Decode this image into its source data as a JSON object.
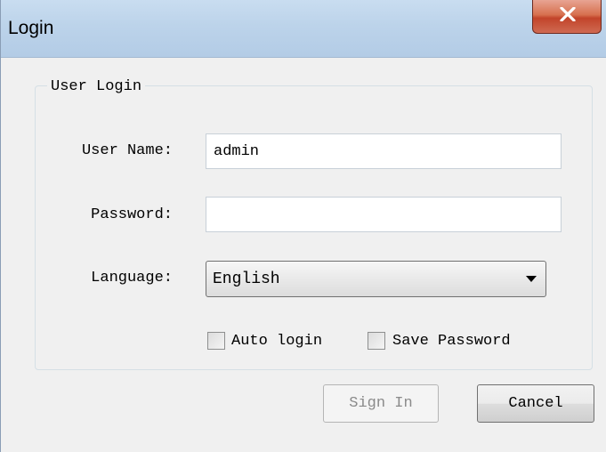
{
  "window": {
    "title": "Login",
    "close_label": "close"
  },
  "group": {
    "label": "User Login"
  },
  "fields": {
    "username": {
      "label": "User Name:",
      "value": "admin",
      "placeholder": ""
    },
    "password": {
      "label": "Password:",
      "value": "",
      "placeholder": ""
    },
    "language": {
      "label": "Language:",
      "selected": "English",
      "options": [
        "English"
      ]
    }
  },
  "options": {
    "auto_login": {
      "label": "Auto login",
      "checked": false
    },
    "save_password": {
      "label": "Save Password",
      "checked": false
    }
  },
  "buttons": {
    "sign_in": {
      "label": "Sign In",
      "enabled": false
    },
    "cancel": {
      "label": "Cancel",
      "enabled": true
    }
  },
  "colors": {
    "titlebar": "#bcd3ea",
    "close_button": "#c2442a",
    "dialog_background": "#f0f0f0"
  },
  "icons": {
    "close": "close-icon",
    "dropdown": "chevron-down-icon"
  }
}
